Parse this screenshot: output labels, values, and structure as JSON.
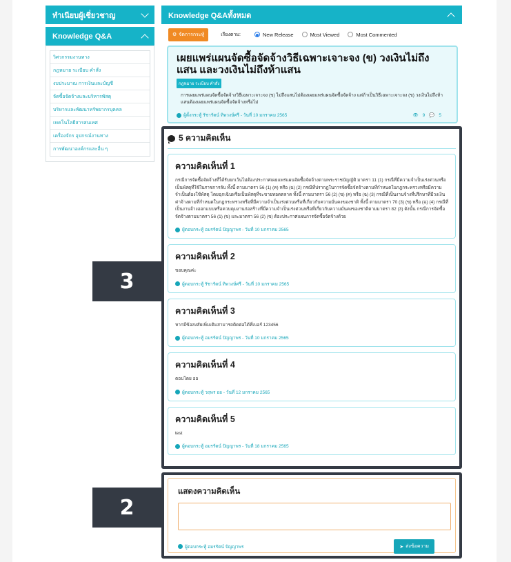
{
  "sidebar": {
    "section1_label": "ทำเนียบผู้เชี่ยวชาญ",
    "section2_label": "Knowledge Q&A",
    "items": [
      "วิศวกรรมงานทาง",
      "กฎหมาย ระเบียบ คำสั่ง",
      "งบประมาณ การเงินและบัญชี",
      "จัดซื้อจัดจ้างและบริหารพัสดุ",
      "บริหารและพัฒนาทรัพยากรบุคคล",
      "เทคโนโลยีสารสนเทศ",
      "เครื่องจักร อุปกรณ์งานทาง",
      "การพัฒนาองค์กรและอื่น ๆ"
    ]
  },
  "main": {
    "header_title": "Knowledge Q&Aทั้งหมด",
    "manage_label": "จัดการกระทู้",
    "sort_label": "เรียงตาม:",
    "sort_options": [
      "New Release",
      "Most Viewed",
      "Most Commented"
    ]
  },
  "article": {
    "title": "เผยแพร่แผนจัดซื้อจัดจ้างวิธีเฉพาะเจาะจง (ข) วงเงินไม่ถึงแสน และวงเงินไม่ถึงห้าแสน",
    "tag": "กฎหมาย ระเบียบ คำสั่ง",
    "body": "การเผยแพร่แผนจัดซื้อจัดจ้างวิธีเฉพาะเจาะจง (ข) ไม่ถึงแสนไม่ต้องเผยแพร่แผนจัดซื้อจัดจ้าง แต่ถ้าเป็นวิธีเฉพาะเจาะจง (ข) วงเงินไม่ถึงห้าแสนต้องเผยแพร่แผนจัดซื้อจัดจ้างหรือไม่",
    "meta": "ผู้ตั้งกระทู้ รัชารัตน์ ทิพวงษ์ศรี - วันที่ 10 มกราคม 2565",
    "views": "9",
    "comments": "5"
  },
  "comments_section": {
    "heading": "5 ความคิดเห็น",
    "items": [
      {
        "title": "ความคิดเห็นที่ 1",
        "text": "กรณีการจัดซื้อจัดจ้างที่ได้รับยกเว้นไม่ต้องประกาศเผยแพร่แผนจัดซื้อจัดจ้างตามพระราชบัญญัติ มาตรา 11 (1) กรณีที่มีความจำเป็นเร่งด่วนหรือเป็นพัสดุที่ใช้ในราชการลับ ทั้งนี้ ตามมาตรา 56 (1) (ค) หรือ (ฉ) (2) กรณีที่ปรากฏในการจัดซื้อจัดจ้างตามที่กำหนดในกฎกระทรวงหรือมีความจำเป็นต้องใช้พัสดุ โดยฉุกเฉินหรือเป็นพัสดุที่จะขายทอดตลาด ทั้งนี้ ตามมาตรา 56 (2) (ข) (ค) หรือ (ฉ) (3) กรณีที่เป็นงานจ้างที่ปรึกษาที่มีวงเงินค่าจ้างตามที่กำหนดในกฎกระทรวงหรือที่มีความจำเป็นเร่งด่วนหรือที่เกี่ยวกับความมั่นคงของชาติ ทั้งนี้ ตามมาตรา 70 (3) (ข) หรือ (ฉ) (4) กรณีที่เป็นงานจ้างออกแบบหรือควบคุมงานก่อสร้างที่มีความจำเป็นเร่งด่วนหรือที่เกี่ยวกับความมั่นคงของชาติตามมาตรา 82 (3) ดังนั้น กรณีการจัดซื้อจัดจ้างตามมาตรา 56 (1) (ข) และมาตรา 56 (2) (ข) ต้องประกาศแผนการจัดซื้อจัดจ้างด้วย",
        "meta": "ผู้ตอบกระทู้ อมรรัตน์ ปัญญาพร - วันที่ 10 มกราคม 2565"
      },
      {
        "title": "ความคิดเห็นที่ 2",
        "text": "ขอบคุณค่ะ",
        "meta": "ผู้ตอบกระทู้ รัชารัตน์ ทิพวงษ์ศรี - วันที่ 10 มกราคม 2565"
      },
      {
        "title": "ความคิดเห็นที่ 3",
        "text": "หากมีข้อสงสัยเพิ่มเติมสามารถติดต่อได้ที่เบอร์ 123456",
        "meta": "ผู้ตอบกระทู้ อมรรัตน์ ปัญญาพร - วันที่ 10 มกราคม 2565"
      },
      {
        "title": "ความคิดเห็นที่ 4",
        "text": "ตอบโดย ออ",
        "meta": "ผู้ตอบกระทู้ วฤพร ออ - วันที่ 12 มกราคม 2565"
      },
      {
        "title": "ความคิดเห็นที่ 5",
        "text": "test",
        "meta": "ผู้ตอบกระทู้ อมรรัตน์ ปัญญาพร - วันที่ 18 มกราคม 2565"
      }
    ]
  },
  "reply": {
    "title": "แสดงความคิดเห็น",
    "textarea_value": "",
    "user": "ผู้ตอบกระทู้ อมรรัตน์ ปัญญาพร",
    "send_label": "ส่งข้อความ"
  },
  "callouts": {
    "c3": "3",
    "c2": "2"
  },
  "colors": {
    "accent": "#16b3c8",
    "orange": "#f08a24",
    "callout_bg": "#343a44"
  }
}
